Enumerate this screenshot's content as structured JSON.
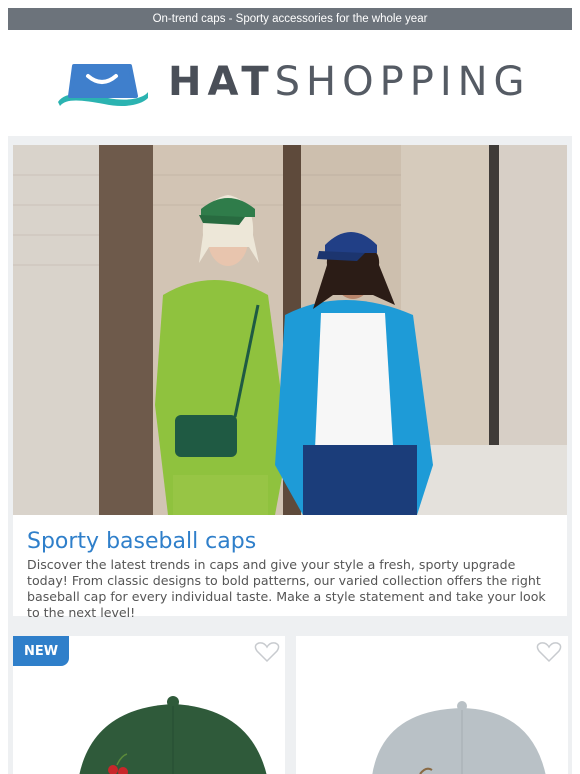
{
  "topbar": {
    "text": "On-trend caps - Sporty accessories for the whole year"
  },
  "logo": {
    "part1": "HAT",
    "part2": "SHOPPING",
    "icon": "hat-bag-icon"
  },
  "hero": {
    "image": "two-models-wearing-caps-photo",
    "title": "Sporty baseball caps",
    "description": "Discover the latest trends in caps and give your style a fresh, sporty upgrade today! From classic designs to bold patterns, our varied collection offers the right baseball cap for every individual taste. Make a style statement and take your look to the next level!"
  },
  "products": [
    {
      "badge": "NEW",
      "icon": "heart-icon",
      "cap_color": "#2f5a3a",
      "image": "green-cap-with-cherries"
    },
    {
      "icon": "heart-icon",
      "cap_color": "#b9c1c6",
      "image": "grey-cap"
    }
  ],
  "colors": {
    "accent": "#2f7fca",
    "topbar": "#6c737b",
    "panel": "#eef0f2"
  }
}
